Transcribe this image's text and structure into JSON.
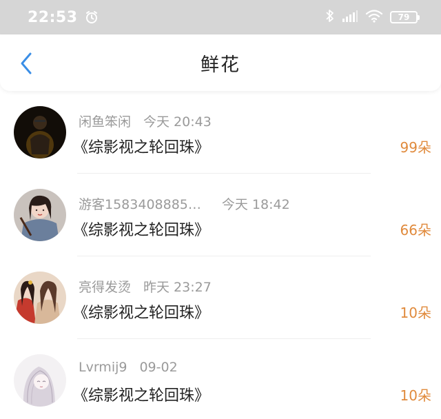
{
  "status_bar": {
    "time": "22:53",
    "battery": "79",
    "icons": [
      "alarm-icon",
      "bluetooth-icon",
      "signal-icon",
      "wifi-icon",
      "battery-icon"
    ]
  },
  "nav": {
    "title": "鲜花",
    "back_icon": "chevron-left-icon"
  },
  "colors": {
    "accent": "#e08a3c",
    "back": "#3a8ee6",
    "status_bar": "#d6d6d6"
  },
  "rows": [
    {
      "name": "闲鱼笨闲",
      "time": "今天 20:43",
      "book": "《综影视之轮回珠》",
      "count": "99朵"
    },
    {
      "name": "游客1583408885…",
      "time": "今天 18:42",
      "book": "《综影视之轮回珠》",
      "count": "66朵"
    },
    {
      "name": "亮得发烫",
      "time": "昨天 23:27",
      "book": "《综影视之轮回珠》",
      "count": "10朵"
    },
    {
      "name": "Lvrmij9",
      "time": "09-02",
      "book": "《综影视之轮回珠》",
      "count": "10朵"
    }
  ]
}
